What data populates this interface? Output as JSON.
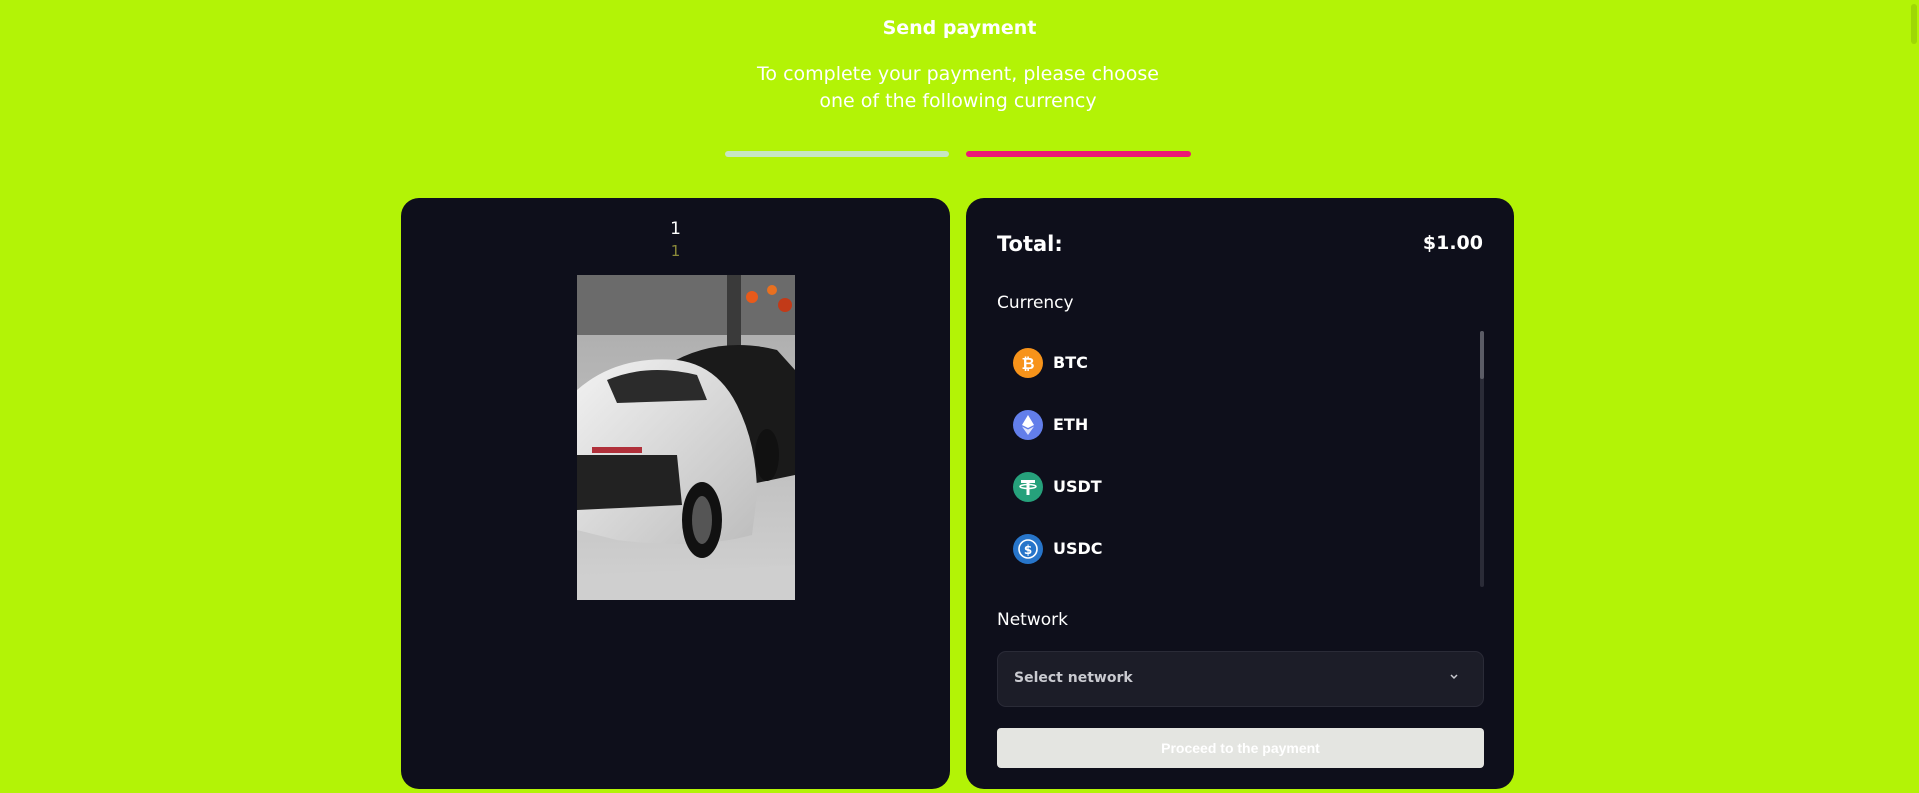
{
  "header": {
    "title": "Send payment",
    "subtitle": "To complete your payment, please choose one of the following currency"
  },
  "progress": {
    "current_step": 2,
    "total_steps": 2,
    "colors": {
      "completed": "#c7e6c2",
      "active": "#ec1874"
    }
  },
  "product": {
    "counter_top": "1",
    "counter_bottom": "1",
    "image_description_icon": "car-photo-icon"
  },
  "checkout": {
    "total_label": "Total:",
    "total_value": "$1.00",
    "currency_label": "Currency",
    "currencies": [
      {
        "code": "BTC",
        "icon": "bitcoin-icon",
        "color": "#f7931a"
      },
      {
        "code": "ETH",
        "icon": "ethereum-icon",
        "color": "#627eea"
      },
      {
        "code": "USDT",
        "icon": "tether-icon",
        "color": "#26a17b"
      },
      {
        "code": "USDC",
        "icon": "usdc-icon",
        "color": "#2775ca"
      }
    ],
    "network_label": "Network",
    "network_placeholder": "Select network",
    "proceed_label": "Proceed to the payment"
  },
  "theme": {
    "background": "#b3f306",
    "panel": "#0e0f1b",
    "accent": "#ec1874"
  }
}
